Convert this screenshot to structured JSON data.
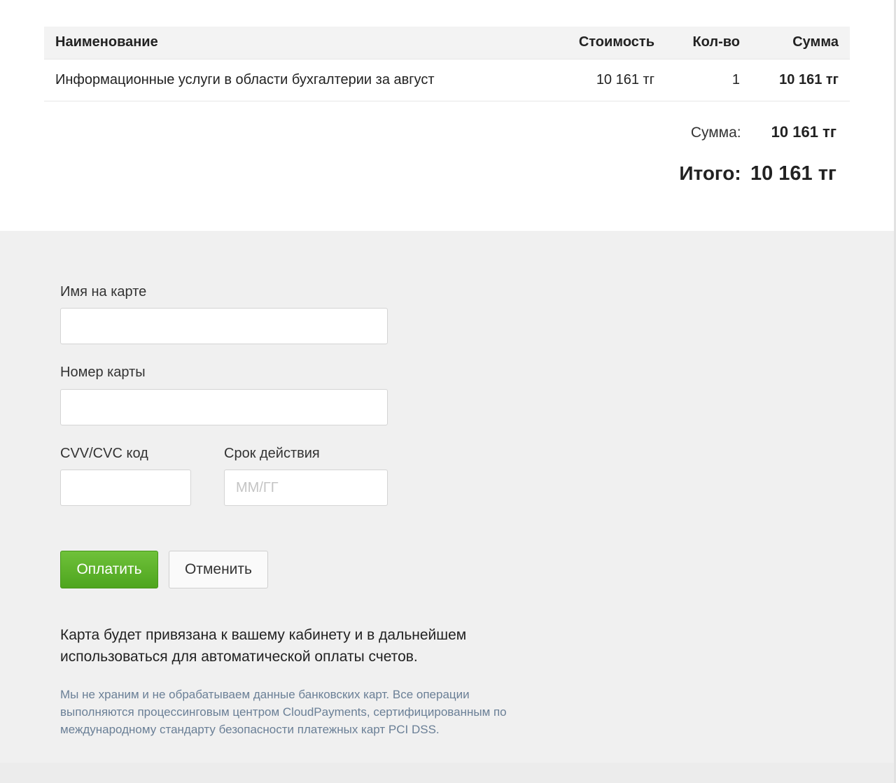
{
  "invoice": {
    "columns": {
      "name": "Наименование",
      "price": "Стоимость",
      "qty": "Кол-во",
      "sum": "Сумма"
    },
    "items": [
      {
        "name": "Информационные услуги в области бухгалтерии за август",
        "price": "10 161 тг",
        "qty": "1",
        "sum": "10 161 тг"
      }
    ],
    "totals": {
      "subtotal_label": "Сумма:",
      "subtotal_value": "10 161 тг",
      "total_label": "Итого:",
      "total_value": "10 161 тг"
    }
  },
  "payment_form": {
    "card_name_label": "Имя на карте",
    "card_name_value": "",
    "card_number_label": "Номер карты",
    "card_number_value": "",
    "cvv_label": "CVV/CVC код",
    "cvv_value": "",
    "expiry_label": "Срок действия",
    "expiry_placeholder": "ММ/ГГ",
    "pay_button": "Оплатить",
    "cancel_button": "Отменить",
    "notice": "Карта будет привязана к вашему кабинету и в дальнейшем использоваться для автоматической оплаты счетов.",
    "disclaimer": "Мы не храним и не обрабатываем данные банковских карт. Все операции выполняются процессинговым центром CloudPayments, сертифицированным по международному стандарту безопасности платежных карт PCI DSS."
  },
  "colors": {
    "pay_button": "#5cb32b",
    "disclaimer_text": "#6a7f96",
    "form_background": "#f0f0f0"
  }
}
